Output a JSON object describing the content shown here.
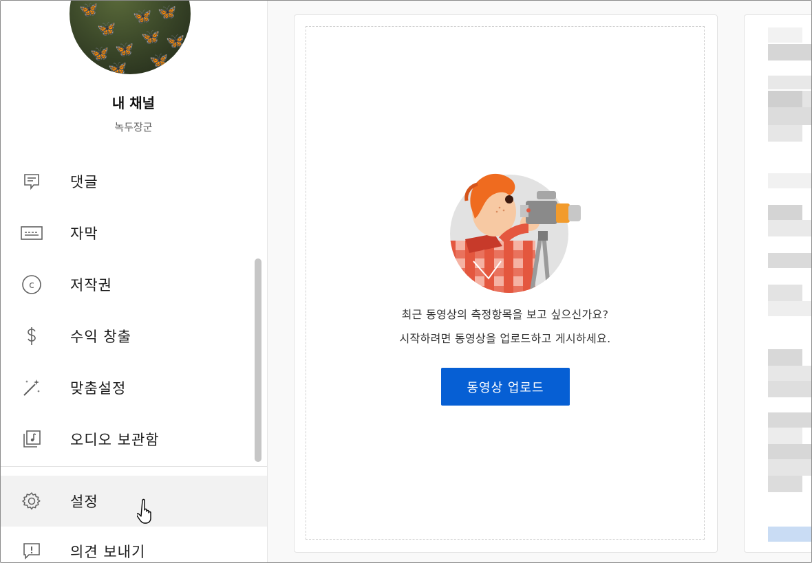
{
  "channel": {
    "title": "내 채널",
    "name": "녹두장군"
  },
  "sidebar": {
    "items": [
      {
        "label": "댓글",
        "icon": "comment-icon"
      },
      {
        "label": "자막",
        "icon": "subtitles-icon"
      },
      {
        "label": "저작권",
        "icon": "copyright-icon"
      },
      {
        "label": "수익 창출",
        "icon": "dollar-icon"
      },
      {
        "label": "맞춤설정",
        "icon": "magic-wand-icon"
      },
      {
        "label": "오디오 보관함",
        "icon": "audio-library-icon"
      }
    ],
    "bottom_items": [
      {
        "label": "설정",
        "icon": "gear-icon",
        "active": true
      },
      {
        "label": "의견 보내기",
        "icon": "feedback-icon"
      }
    ]
  },
  "main": {
    "message_line1": "최근 동영상의 측정항목을 보고 싶으신가요?",
    "message_line2": "시작하려면 동영상을 업로드하고 게시하세요.",
    "upload_label": "동영상 업로드"
  },
  "colors": {
    "accent": "#065fd4",
    "active_bg": "#f2f2f2"
  }
}
